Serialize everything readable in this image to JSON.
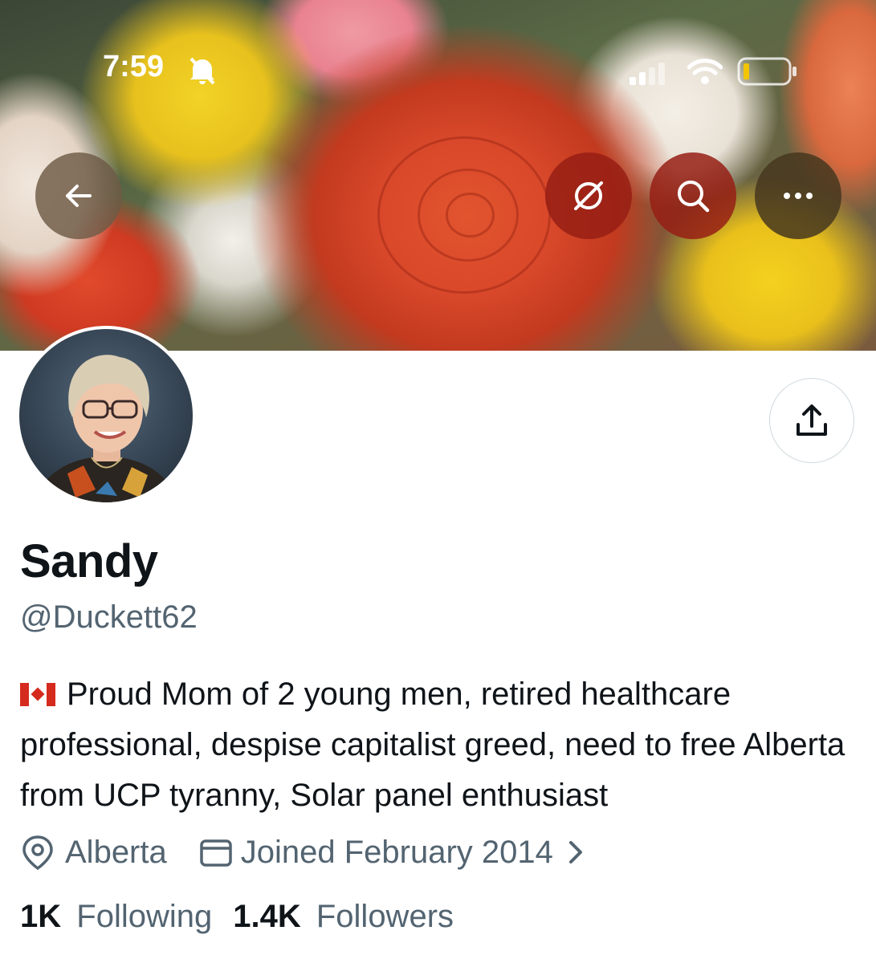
{
  "status_bar": {
    "time": "7:59"
  },
  "banner_actions": {
    "back_icon": "arrow-left-icon",
    "mute_icon": "slashed-circle-icon",
    "search_icon": "search-icon",
    "more_icon": "more-horizontal-icon"
  },
  "profile": {
    "name": "Sandy",
    "handle": "@Duckett62",
    "bio": "Proud Mom of 2 young men, retired healthcare professional, despise capitalist greed, need to free Alberta from UCP tyranny, Solar panel enthusiast",
    "location": "Alberta",
    "joined": "Joined February 2014",
    "following_count": "1K",
    "following_label": "Following",
    "followers_count": "1.4K",
    "followers_label": "Followers"
  },
  "colors": {
    "primary_text": "#0f1419",
    "secondary_text": "#536471",
    "border": "#cfd9de"
  }
}
